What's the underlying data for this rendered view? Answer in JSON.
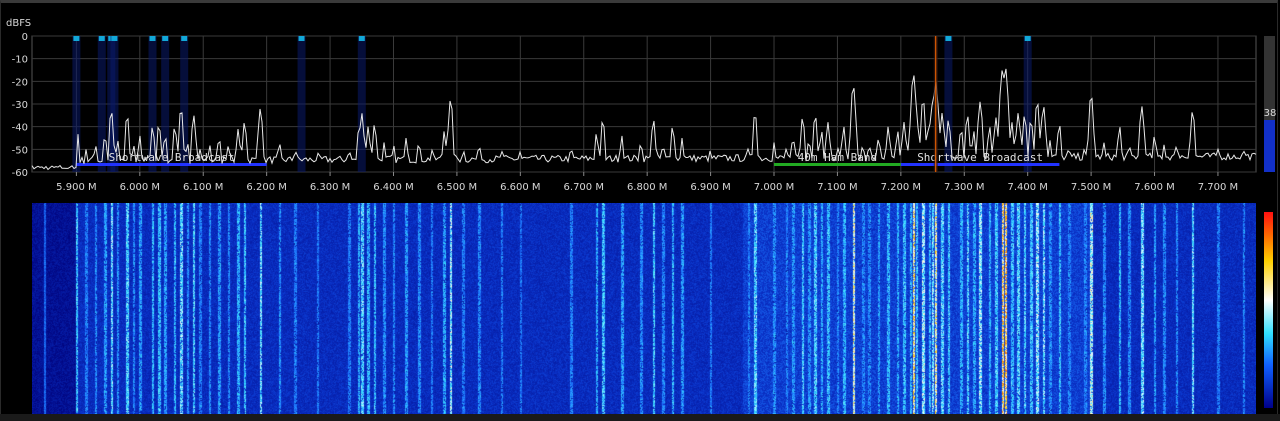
{
  "axis": {
    "unit_label": "dBFS",
    "y_ticks": [
      "0",
      "-10",
      "-20",
      "-30",
      "-40",
      "-50",
      "-60"
    ],
    "y_range": [
      -60,
      0
    ],
    "x_range_mhz": [
      5.83,
      7.76
    ],
    "x_ticks": [
      {
        "mhz": 5.9,
        "label": "5.900 M"
      },
      {
        "mhz": 6.0,
        "label": "6.000 M"
      },
      {
        "mhz": 6.1,
        "label": "6.100 M"
      },
      {
        "mhz": 6.2,
        "label": "6.200 M"
      },
      {
        "mhz": 6.3,
        "label": "6.300 M"
      },
      {
        "mhz": 6.4,
        "label": "6.400 M"
      },
      {
        "mhz": 6.5,
        "label": "6.500 M"
      },
      {
        "mhz": 6.6,
        "label": "6.600 M"
      },
      {
        "mhz": 6.7,
        "label": "6.700 M"
      },
      {
        "mhz": 6.8,
        "label": "6.800 M"
      },
      {
        "mhz": 6.9,
        "label": "6.900 M"
      },
      {
        "mhz": 7.0,
        "label": "7.000 M"
      },
      {
        "mhz": 7.1,
        "label": "7.100 M"
      },
      {
        "mhz": 7.2,
        "label": "7.200 M"
      },
      {
        "mhz": 7.3,
        "label": "7.300 M"
      },
      {
        "mhz": 7.4,
        "label": "7.400 M"
      },
      {
        "mhz": 7.5,
        "label": "7.500 M"
      },
      {
        "mhz": 7.6,
        "label": "7.600 M"
      },
      {
        "mhz": 7.7,
        "label": "7.700 M"
      }
    ]
  },
  "bands": [
    {
      "label": "Shortwave Broadcast",
      "start_mhz": 5.9,
      "end_mhz": 6.2,
      "color": "#2233ff"
    },
    {
      "label": "40m Ham Band",
      "start_mhz": 7.0,
      "end_mhz": 7.2,
      "color": "#22aa22"
    },
    {
      "label": "Shortwave Broadcast",
      "start_mhz": 7.2,
      "end_mhz": 7.45,
      "color": "#2233ff"
    }
  ],
  "markers_mhz": [
    5.9,
    5.94,
    5.955,
    5.96,
    6.02,
    6.04,
    6.07,
    6.255,
    6.35,
    7.275,
    7.4
  ],
  "tuned_mhz": 7.255,
  "peaks": [
    {
      "f": 5.85,
      "db": -56
    },
    {
      "f": 5.9,
      "db": -38
    },
    {
      "f": 5.915,
      "db": -50
    },
    {
      "f": 5.93,
      "db": -48
    },
    {
      "f": 5.945,
      "db": -44
    },
    {
      "f": 5.955,
      "db": -33
    },
    {
      "f": 5.965,
      "db": -46
    },
    {
      "f": 5.98,
      "db": -35
    },
    {
      "f": 5.99,
      "db": -48
    },
    {
      "f": 6.0,
      "db": -44
    },
    {
      "f": 6.02,
      "db": -40
    },
    {
      "f": 6.03,
      "db": -39
    },
    {
      "f": 6.04,
      "db": -44
    },
    {
      "f": 6.055,
      "db": -40
    },
    {
      "f": 6.065,
      "db": -32
    },
    {
      "f": 6.075,
      "db": -47
    },
    {
      "f": 6.085,
      "db": -35
    },
    {
      "f": 6.095,
      "db": -50
    },
    {
      "f": 6.11,
      "db": -48
    },
    {
      "f": 6.125,
      "db": -45
    },
    {
      "f": 6.14,
      "db": -48
    },
    {
      "f": 6.155,
      "db": -41
    },
    {
      "f": 6.165,
      "db": -38
    },
    {
      "f": 6.19,
      "db": -32
    },
    {
      "f": 6.22,
      "db": -47
    },
    {
      "f": 6.245,
      "db": -50
    },
    {
      "f": 6.28,
      "db": -51
    },
    {
      "f": 6.33,
      "db": -50
    },
    {
      "f": 6.345,
      "db": -42
    },
    {
      "f": 6.35,
      "db": -34
    },
    {
      "f": 6.36,
      "db": -40
    },
    {
      "f": 6.37,
      "db": -39
    },
    {
      "f": 6.385,
      "db": -47
    },
    {
      "f": 6.4,
      "db": -48
    },
    {
      "f": 6.42,
      "db": -45
    },
    {
      "f": 6.44,
      "db": -47
    },
    {
      "f": 6.46,
      "db": -50
    },
    {
      "f": 6.48,
      "db": -42
    },
    {
      "f": 6.49,
      "db": -28
    },
    {
      "f": 6.51,
      "db": -50
    },
    {
      "f": 6.535,
      "db": -48
    },
    {
      "f": 6.57,
      "db": -50
    },
    {
      "f": 6.6,
      "db": -51
    },
    {
      "f": 6.68,
      "db": -49
    },
    {
      "f": 6.72,
      "db": -43
    },
    {
      "f": 6.73,
      "db": -37
    },
    {
      "f": 6.76,
      "db": -44
    },
    {
      "f": 6.79,
      "db": -47
    },
    {
      "f": 6.81,
      "db": -37
    },
    {
      "f": 6.825,
      "db": -48
    },
    {
      "f": 6.84,
      "db": -40
    },
    {
      "f": 6.855,
      "db": -45
    },
    {
      "f": 6.9,
      "db": -50
    },
    {
      "f": 6.96,
      "db": -49
    },
    {
      "f": 6.97,
      "db": -34
    },
    {
      "f": 7.0,
      "db": -47
    },
    {
      "f": 7.02,
      "db": -49
    },
    {
      "f": 7.03,
      "db": -45
    },
    {
      "f": 7.045,
      "db": -36
    },
    {
      "f": 7.055,
      "db": -46
    },
    {
      "f": 7.065,
      "db": -35
    },
    {
      "f": 7.075,
      "db": -42
    },
    {
      "f": 7.085,
      "db": -38
    },
    {
      "f": 7.1,
      "db": -49
    },
    {
      "f": 7.11,
      "db": -40
    },
    {
      "f": 7.125,
      "db": -22
    },
    {
      "f": 7.14,
      "db": -48
    },
    {
      "f": 7.15,
      "db": -48
    },
    {
      "f": 7.165,
      "db": -45
    },
    {
      "f": 7.18,
      "db": -40
    },
    {
      "f": 7.195,
      "db": -42
    },
    {
      "f": 7.205,
      "db": -38
    },
    {
      "f": 7.215,
      "db": -39
    },
    {
      "f": 7.22,
      "db": -17
    },
    {
      "f": 7.225,
      "db": -37
    },
    {
      "f": 7.235,
      "db": -28
    },
    {
      "f": 7.245,
      "db": -38
    },
    {
      "f": 7.25,
      "db": -30
    },
    {
      "f": 7.255,
      "db": -20
    },
    {
      "f": 7.265,
      "db": -34
    },
    {
      "f": 7.275,
      "db": -37
    },
    {
      "f": 7.295,
      "db": -41
    },
    {
      "f": 7.305,
      "db": -35
    },
    {
      "f": 7.315,
      "db": -42
    },
    {
      "f": 7.325,
      "db": -29
    },
    {
      "f": 7.34,
      "db": -40
    },
    {
      "f": 7.35,
      "db": -36
    },
    {
      "f": 7.36,
      "db": -15
    },
    {
      "f": 7.365,
      "db": -14
    },
    {
      "f": 7.375,
      "db": -38
    },
    {
      "f": 7.385,
      "db": -34
    },
    {
      "f": 7.395,
      "db": -35
    },
    {
      "f": 7.405,
      "db": -37
    },
    {
      "f": 7.415,
      "db": -29
    },
    {
      "f": 7.425,
      "db": -31
    },
    {
      "f": 7.435,
      "db": -46
    },
    {
      "f": 7.45,
      "db": -39
    },
    {
      "f": 7.465,
      "db": -49
    },
    {
      "f": 7.49,
      "db": -49
    },
    {
      "f": 7.5,
      "db": -26
    },
    {
      "f": 7.52,
      "db": -47
    },
    {
      "f": 7.545,
      "db": -40
    },
    {
      "f": 7.56,
      "db": -48
    },
    {
      "f": 7.58,
      "db": -31
    },
    {
      "f": 7.6,
      "db": -44
    },
    {
      "f": 7.615,
      "db": -48
    },
    {
      "f": 7.635,
      "db": -48
    },
    {
      "f": 7.66,
      "db": -33
    },
    {
      "f": 7.7,
      "db": -50
    },
    {
      "f": 7.74,
      "db": -50
    }
  ],
  "level": {
    "value": "38",
    "fraction": 0.38
  },
  "colors": {
    "trace": "#e8e8e8",
    "grid": "#3a3a3a",
    "marker": "#12a8d8",
    "tuned": "#ff6a00",
    "text": "#d8d8d8"
  }
}
